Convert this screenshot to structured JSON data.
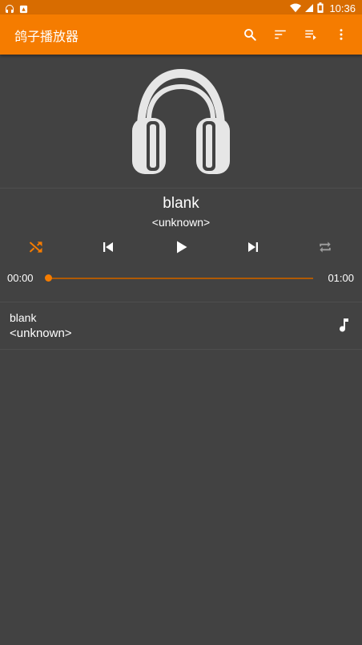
{
  "status_bar": {
    "time": "10:36",
    "left_icons": [
      "headphones-icon",
      "notification-icon"
    ],
    "right_icons": [
      "wifi-icon",
      "signal-icon",
      "battery-icon"
    ]
  },
  "toolbar": {
    "title": "鸽子播放器",
    "background": "#f57c00",
    "actions": [
      "search-icon",
      "sort-icon",
      "playlist-add-icon",
      "more-vert-icon"
    ]
  },
  "player": {
    "album_art_icon": "headphones-icon",
    "title": "blank",
    "artist": "<unknown>",
    "controls": [
      "shuffle-icon",
      "skip-previous-icon",
      "play-icon",
      "skip-next-icon",
      "repeat-icon"
    ],
    "shuffle_active": true,
    "accent": "#f57c00",
    "elapsed": "00:00",
    "duration": "01:00",
    "progress": 0
  },
  "playlist": [
    {
      "title": "blank",
      "artist": "<unknown>",
      "icon": "music-note-icon"
    }
  ]
}
